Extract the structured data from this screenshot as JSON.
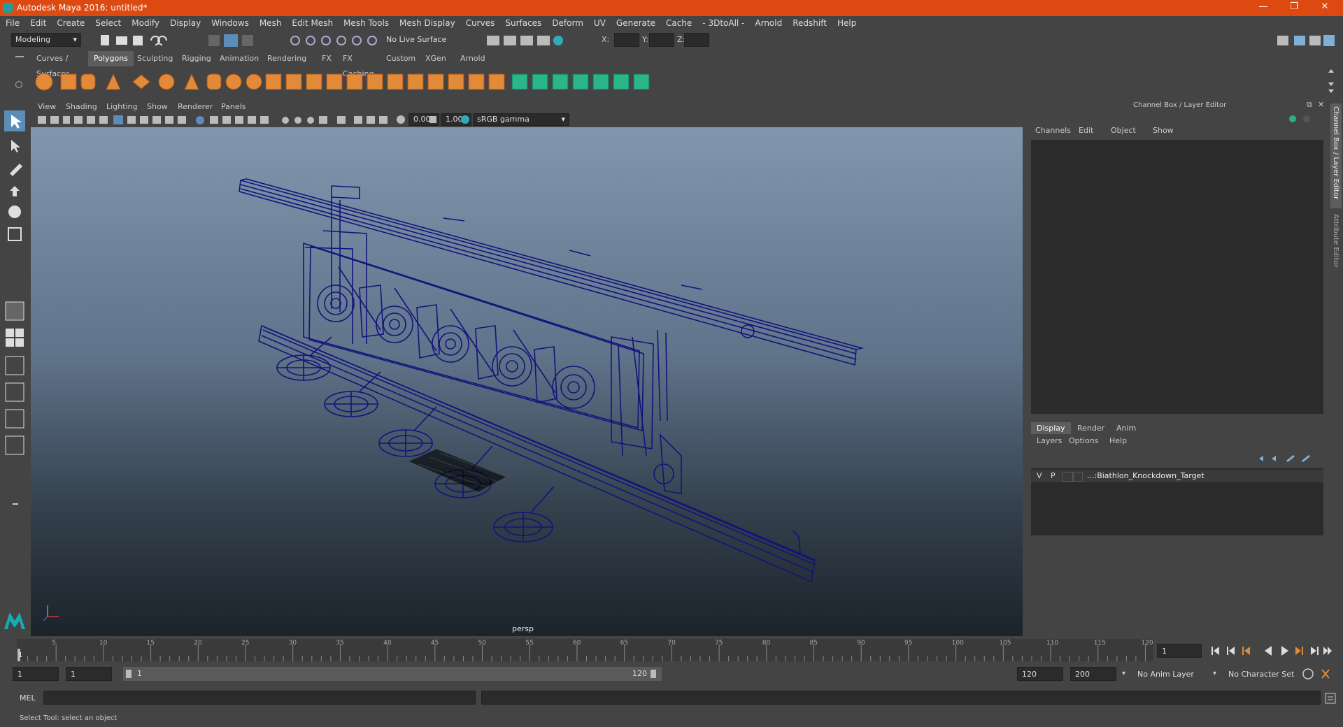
{
  "window": {
    "title": "Autodesk Maya 2016: untitled*"
  },
  "menu": [
    "File",
    "Edit",
    "Create",
    "Select",
    "Modify",
    "Display",
    "Windows",
    "Mesh",
    "Edit Mesh",
    "Mesh Tools",
    "Mesh Display",
    "Curves",
    "Surfaces",
    "Deform",
    "UV",
    "Generate",
    "Cache",
    "- 3DtoAll -",
    "Arnold",
    "Redshift",
    "Help"
  ],
  "status": {
    "mode": "Modeling",
    "live_surface": "No Live Surface",
    "x_label": "X:",
    "y_label": "Y:",
    "z_label": "Z:"
  },
  "shelf_tabs": [
    "Curves / Surfaces",
    "Polygons",
    "Sculpting",
    "Rigging",
    "Animation",
    "Rendering",
    "FX",
    "FX Caching",
    "Custom",
    "XGen",
    "Arnold"
  ],
  "shelf_active": "Polygons",
  "viewport": {
    "menu": [
      "View",
      "Shading",
      "Lighting",
      "Show",
      "Renderer",
      "Panels"
    ],
    "exposure": "0.00",
    "gamma": "1.00",
    "color_space": "sRGB gamma",
    "camera_label": "persp"
  },
  "channel_box": {
    "title": "Channel Box / Layer Editor",
    "menu": [
      "Channels",
      "Edit",
      "Object",
      "Show"
    ],
    "side_tab_1": "Channel Box / Layer Editor",
    "side_tab_2": "Attribute Editor"
  },
  "layer_editor": {
    "tabs": [
      "Display",
      "Render",
      "Anim"
    ],
    "active_tab": "Display",
    "menu": [
      "Layers",
      "Options",
      "Help"
    ],
    "layer": {
      "v": "V",
      "p": "P",
      "name": "...:Biathlon_Knockdown_Target"
    }
  },
  "timeline": {
    "ticks": [
      "5",
      "10",
      "15",
      "20",
      "25",
      "30",
      "35",
      "40",
      "45",
      "50",
      "55",
      "60",
      "65",
      "70",
      "75",
      "80",
      "85",
      "90",
      "95",
      "100",
      "105",
      "110",
      "115",
      "120"
    ],
    "start_marker": "1",
    "current_frame": "1"
  },
  "range": {
    "start": "1",
    "anim_start": "1",
    "slider_start": "1",
    "slider_end": "120",
    "anim_end": "120",
    "end": "200",
    "anim_layer": "No Anim Layer",
    "char_set": "No Character Set"
  },
  "mel": {
    "label": "MEL"
  },
  "help": {
    "text": "Select Tool: select an object"
  },
  "colors": {
    "title_bar": "#dc4a12",
    "wireframe": "#13147a",
    "accent": "#1aa0a8"
  }
}
